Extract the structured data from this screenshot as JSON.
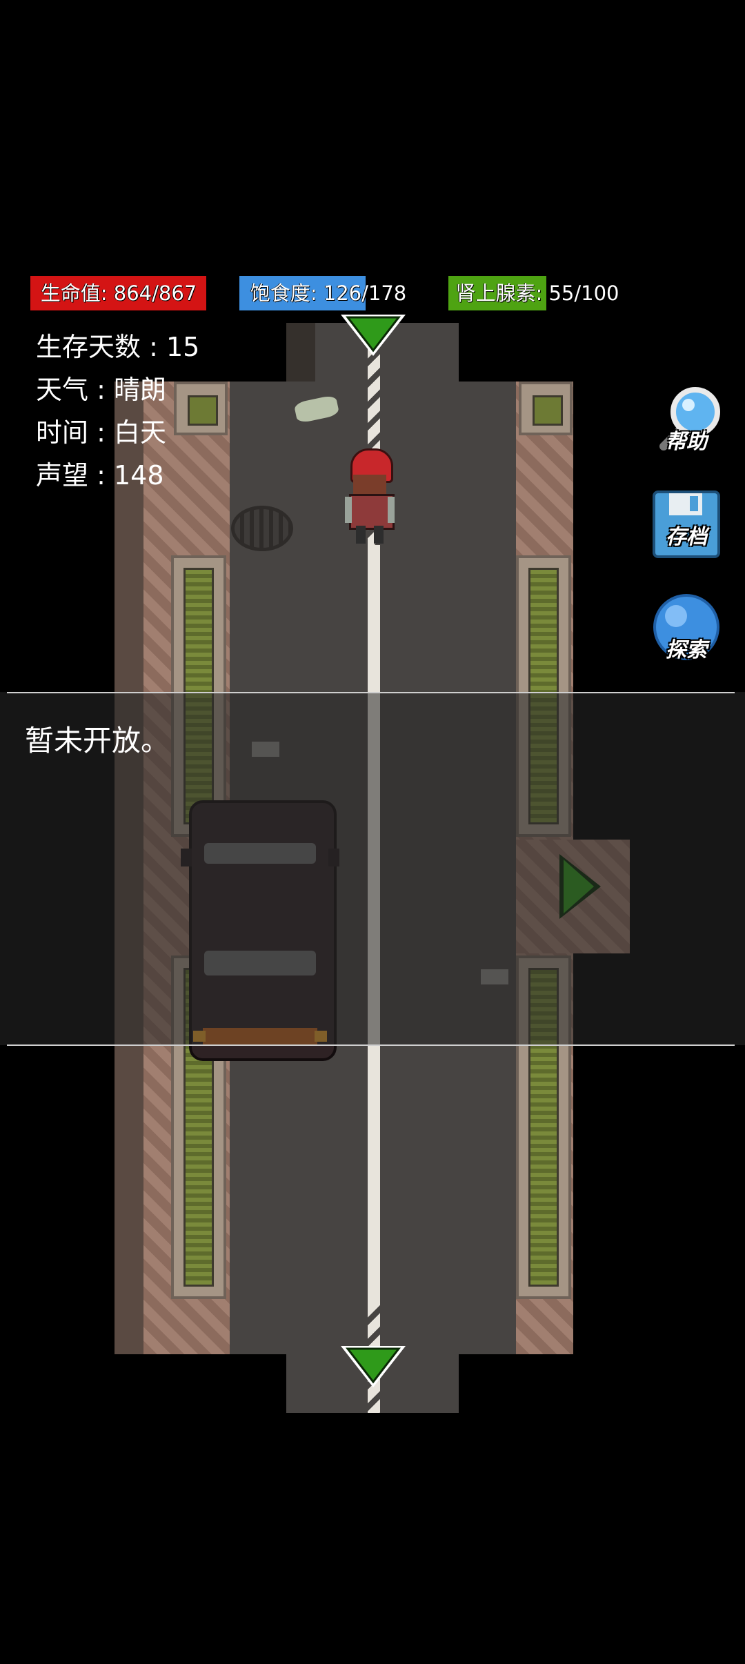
{
  "stats": {
    "hp": {
      "label": "生命值: 864/867",
      "value": 864,
      "max": 867,
      "color": "#d41414"
    },
    "hunger": {
      "label": "饱食度: 126/178",
      "value": 126,
      "max": 178,
      "color": "#3d8fe0"
    },
    "adrenaline": {
      "label": "肾上腺素: 55/100",
      "value": 55,
      "max": 100,
      "color": "#4ea312"
    }
  },
  "info": {
    "days": "生存天数 : 15",
    "weather": "天气 : 晴朗",
    "time": "时间 : 白天",
    "reputation": "声望 : 148"
  },
  "buttons": {
    "help": "帮助",
    "save": "存档",
    "explore": "探索"
  },
  "message": "暂未开放。",
  "colors": {
    "exit_arrow": "#2f9a1a",
    "background": "#000000"
  }
}
